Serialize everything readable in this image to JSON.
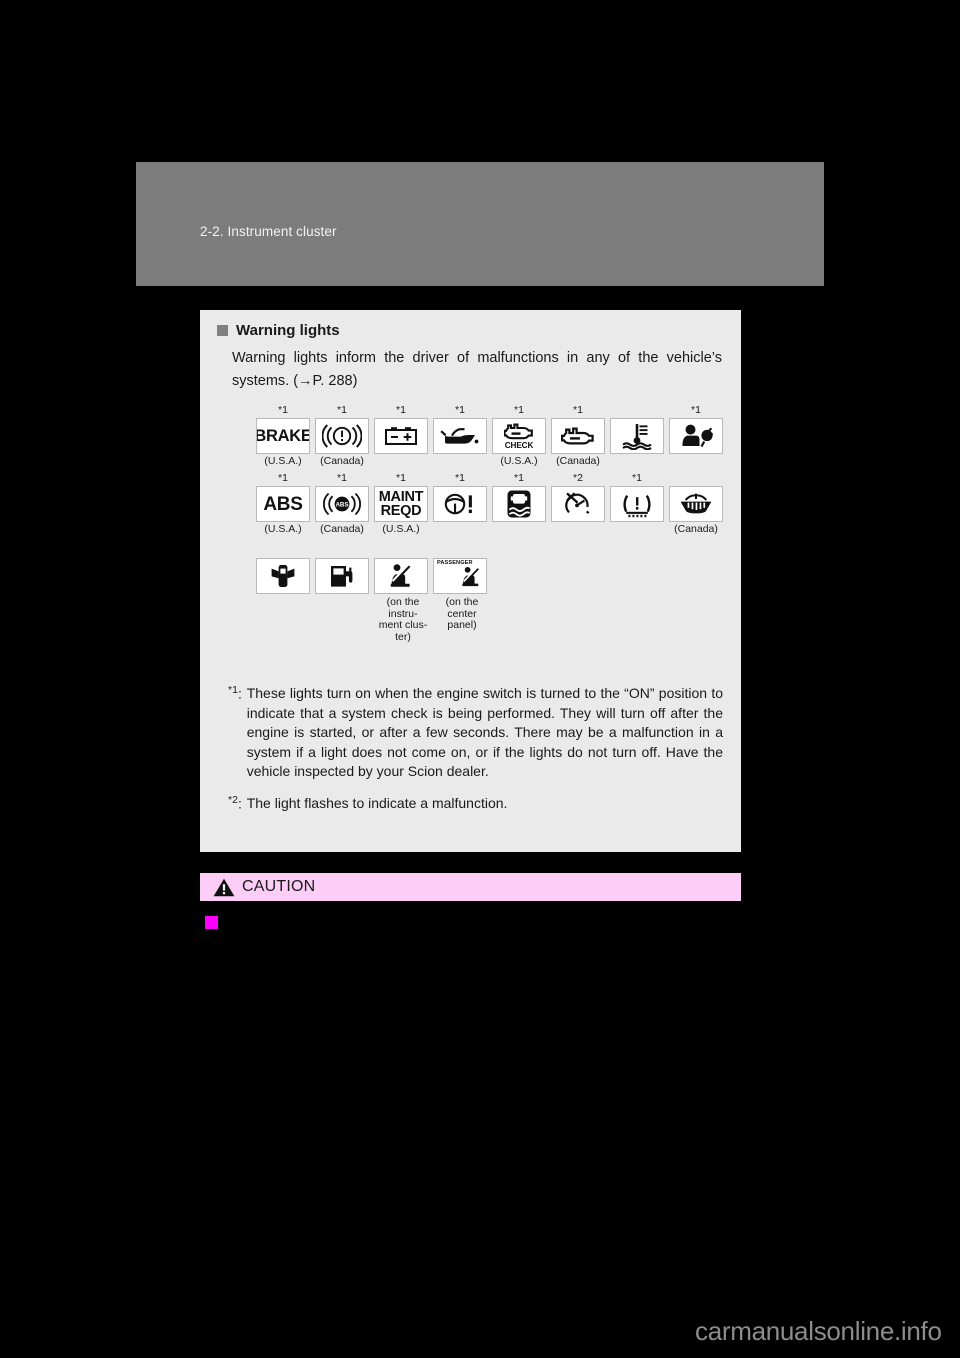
{
  "page": {
    "header_title": "2-2. Instrument cluster",
    "watermark": "carmanualsonline.info"
  },
  "section": {
    "bullet_icon": "square-bullet-icon",
    "heading": "Warning lights",
    "intro": "Warning lights inform the driver of malfunctions in any of the vehicle’s systems. (→P. 288)"
  },
  "icon_rows": [
    {
      "row_id": "warning-lights-row-1",
      "items": [
        {
          "name": "brake-system-warning-icon",
          "star": "*1",
          "label": "BRAKE",
          "region": "(U.S.A.)",
          "note": ""
        },
        {
          "name": "brake-system-warning-canada-icon",
          "star": "*1",
          "label": "",
          "region": "(Canada)",
          "note": ""
        },
        {
          "name": "charging-system-battery-icon",
          "star": "*1",
          "label": "",
          "region": "",
          "note": ""
        },
        {
          "name": "low-engine-oil-pressure-icon",
          "star": "*1",
          "label": "",
          "region": "",
          "note": ""
        },
        {
          "name": "malfunction-indicator-check-icon",
          "star": "*1",
          "label": "CHECK",
          "region": "(U.S.A.)",
          "note": ""
        },
        {
          "name": "malfunction-indicator-canada-icon",
          "star": "*1",
          "label": "",
          "region": "(Canada)",
          "note": ""
        },
        {
          "name": "high-engine-coolant-temperature-icon",
          "star": "",
          "label": "",
          "region": "",
          "note": ""
        },
        {
          "name": "srs-airbag-warning-icon",
          "star": "*1",
          "label": "",
          "region": "",
          "note": ""
        }
      ]
    },
    {
      "row_id": "warning-lights-row-2",
      "items": [
        {
          "name": "abs-warning-icon",
          "star": "*1",
          "label": "ABS",
          "region": "(U.S.A.)",
          "note": ""
        },
        {
          "name": "abs-warning-canada-icon",
          "star": "*1",
          "label": "",
          "region": "(Canada)",
          "note": ""
        },
        {
          "name": "maintenance-required-icon",
          "star": "*1",
          "label": "MAINT REQD",
          "region": "(U.S.A.)",
          "note": ""
        },
        {
          "name": "electric-power-steering-warning-icon",
          "star": "*1",
          "label": "",
          "region": "",
          "note": ""
        },
        {
          "name": "slip-indicator-vsc-icon",
          "star": "*1",
          "label": "",
          "region": "",
          "note": ""
        },
        {
          "name": "vsc-off-indicator-icon",
          "star": "*2",
          "label": "",
          "region": "",
          "note": ""
        },
        {
          "name": "low-tire-pressure-warning-icon",
          "star": "*1",
          "label": "",
          "region": "",
          "note": ""
        },
        {
          "name": "low-washer-fluid-level-icon",
          "star": "",
          "label": "",
          "region": "(Canada)",
          "note": ""
        }
      ]
    },
    {
      "row_id": "warning-lights-row-3",
      "items": [
        {
          "name": "open-door-warning-icon",
          "star": "",
          "label": "",
          "region": "",
          "note": ""
        },
        {
          "name": "low-fuel-level-warning-icon",
          "star": "",
          "label": "",
          "region": "",
          "note": ""
        },
        {
          "name": "driver-seat-belt-reminder-icon",
          "star": "",
          "label": "",
          "region": "",
          "note": "(on the instru-ment clus-ter)"
        },
        {
          "name": "passenger-seat-belt-reminder-icon",
          "star": "",
          "label": "PASSENGER",
          "region": "",
          "note": "(on the center panel)"
        }
      ]
    }
  ],
  "footnotes": [
    {
      "marker": "*1",
      "marker_sep": ":",
      "text": "These lights turn on when the engine switch is turned to the “ON” position to indicate that a system check is being performed. They will turn off after the engine is started, or after a few seconds. There may be a malfunction in a system if a light does not come on, or if the lights do not turn off. Have the vehicle inspected by your Scion dealer."
    },
    {
      "marker": "*2",
      "marker_sep": ":",
      "text": "The light flashes to indicate a malfunction."
    }
  ],
  "caution": {
    "icon": "warning-triangle-icon",
    "title": "CAUTION",
    "bullet_icon": "magenta-square-bullet-icon"
  },
  "colors": {
    "page_background": "#000000",
    "header_band": "#7c7c7c",
    "content_panel": "#eaeaea",
    "caution_band": "#fccdf7",
    "caution_bullet": "#ff00ff",
    "icon_box_background": "#ffffff",
    "icon_box_border": "#b9b9b9",
    "text": "#1a1a1a",
    "watermark": "#8c8c8c"
  },
  "sub_notes": {
    "driver_belt": [
      "(on the",
      "instru-",
      "ment clus-",
      "ter)"
    ],
    "passenger_belt": [
      "(on the",
      "center",
      "panel)"
    ]
  }
}
